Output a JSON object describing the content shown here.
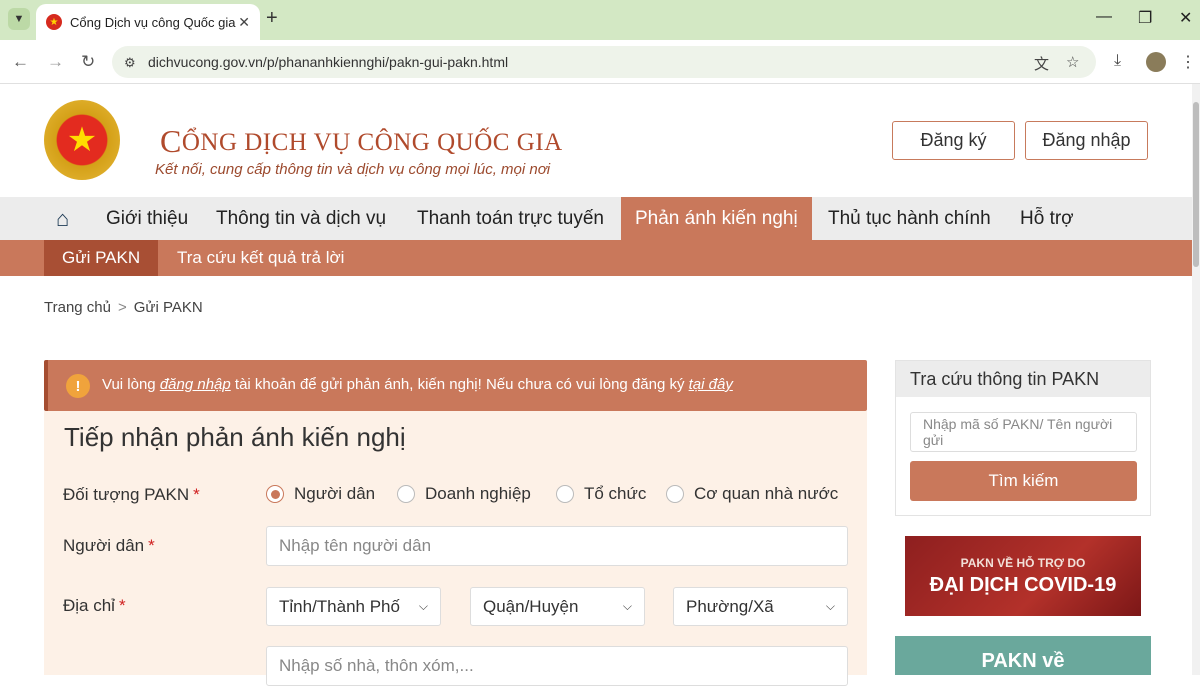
{
  "browser": {
    "tab_title": "Cổng Dịch vụ công Quốc gia",
    "url": "dichvucong.gov.vn/p/phananhkiennghi/pakn-gui-pakn.html"
  },
  "header": {
    "site_first_letter": "C",
    "site_rest": "ỔNG DỊCH VỤ CÔNG QUỐC GIA",
    "slogan": "Kết nối, cung cấp thông tin và dịch vụ công mọi lúc, mọi nơi",
    "register": "Đăng ký",
    "login": "Đăng nhập"
  },
  "nav": {
    "items": [
      "Giới thiệu",
      "Thông tin và dịch vụ",
      "Thanh toán trực tuyến",
      "Phản ánh kiến nghị",
      "Thủ tục hành chính",
      "Hỗ trợ"
    ]
  },
  "subnav": {
    "items": [
      "Gửi PAKN",
      "Tra cứu kết quả trả lời"
    ]
  },
  "breadcrumb": {
    "home": "Trang chủ",
    "sep": ">",
    "current": "Gửi PAKN"
  },
  "alert": {
    "pre": "Vui lòng ",
    "link1": "đăng nhập",
    "mid": " tài khoản để gửi phản ánh, kiến nghị! Nếu chưa có vui lòng đăng ký ",
    "link2": "tại đây"
  },
  "form": {
    "title": "Tiếp nhận phản ánh kiến nghị",
    "subject_label": "Đối tượng PAKN",
    "required": "*",
    "options": [
      "Người dân",
      "Doanh nghiệp",
      "Tổ chức",
      "Cơ quan nhà nước"
    ],
    "selected_option": "Người dân",
    "person_label": "Người dân",
    "person_placeholder": "Nhập tên người dân",
    "address_label": "Địa chỉ",
    "province": "Tỉnh/Thành Phố",
    "district": "Quận/Huyện",
    "ward": "Phường/Xã",
    "street_placeholder": "Nhập số nhà, thôn xóm,..."
  },
  "sidebar": {
    "title": "Tra cứu thông tin PAKN",
    "search_placeholder": "Nhập mã số PAKN/ Tên người gửi",
    "search_button": "Tìm kiếm",
    "banner1_line1": "PAKN VỀ HỖ TRỢ DO",
    "banner1_line2": "ĐẠI DỊCH COVID-19",
    "banner2": "PAKN về"
  },
  "colors": {
    "accent": "#c9785b",
    "accent_dark": "#a84f34",
    "nav_bg": "#ececec",
    "form_bg": "#fdf1e7"
  }
}
